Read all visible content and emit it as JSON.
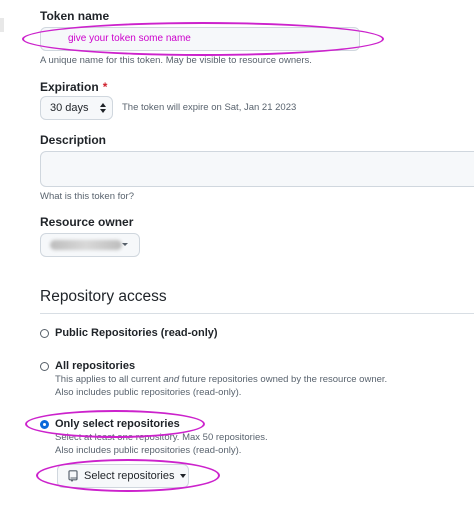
{
  "token_name": {
    "label": "Token name",
    "value": "give your token some name",
    "hint": "A unique name for this token. May be visible to resource owners."
  },
  "expiration": {
    "label": "Expiration",
    "required_marker": "*",
    "selected": "30 days",
    "note": "The token will expire on Sat, Jan 21 2023"
  },
  "description": {
    "label": "Description",
    "value": "",
    "hint": "What is this token for?"
  },
  "resource_owner": {
    "label": "Resource owner"
  },
  "repository_access": {
    "title": "Repository access",
    "options": [
      {
        "label": "Public Repositories (read-only)",
        "selected": false,
        "lines": []
      },
      {
        "label": "All repositories",
        "selected": false,
        "lines": [
          "Also includes public repositories (read-only)."
        ],
        "line1_pre": "This applies to all current ",
        "line1_em": "and",
        "line1_post": " future repositories owned by the resource owner."
      },
      {
        "label": "Only select repositories",
        "selected": true,
        "lines": [
          "Select at least one repository. Max 50 repositories.",
          "Also includes public repositories (read-only)."
        ]
      }
    ],
    "select_button": "Select repositories"
  },
  "annotation_color": "#cc22cc"
}
